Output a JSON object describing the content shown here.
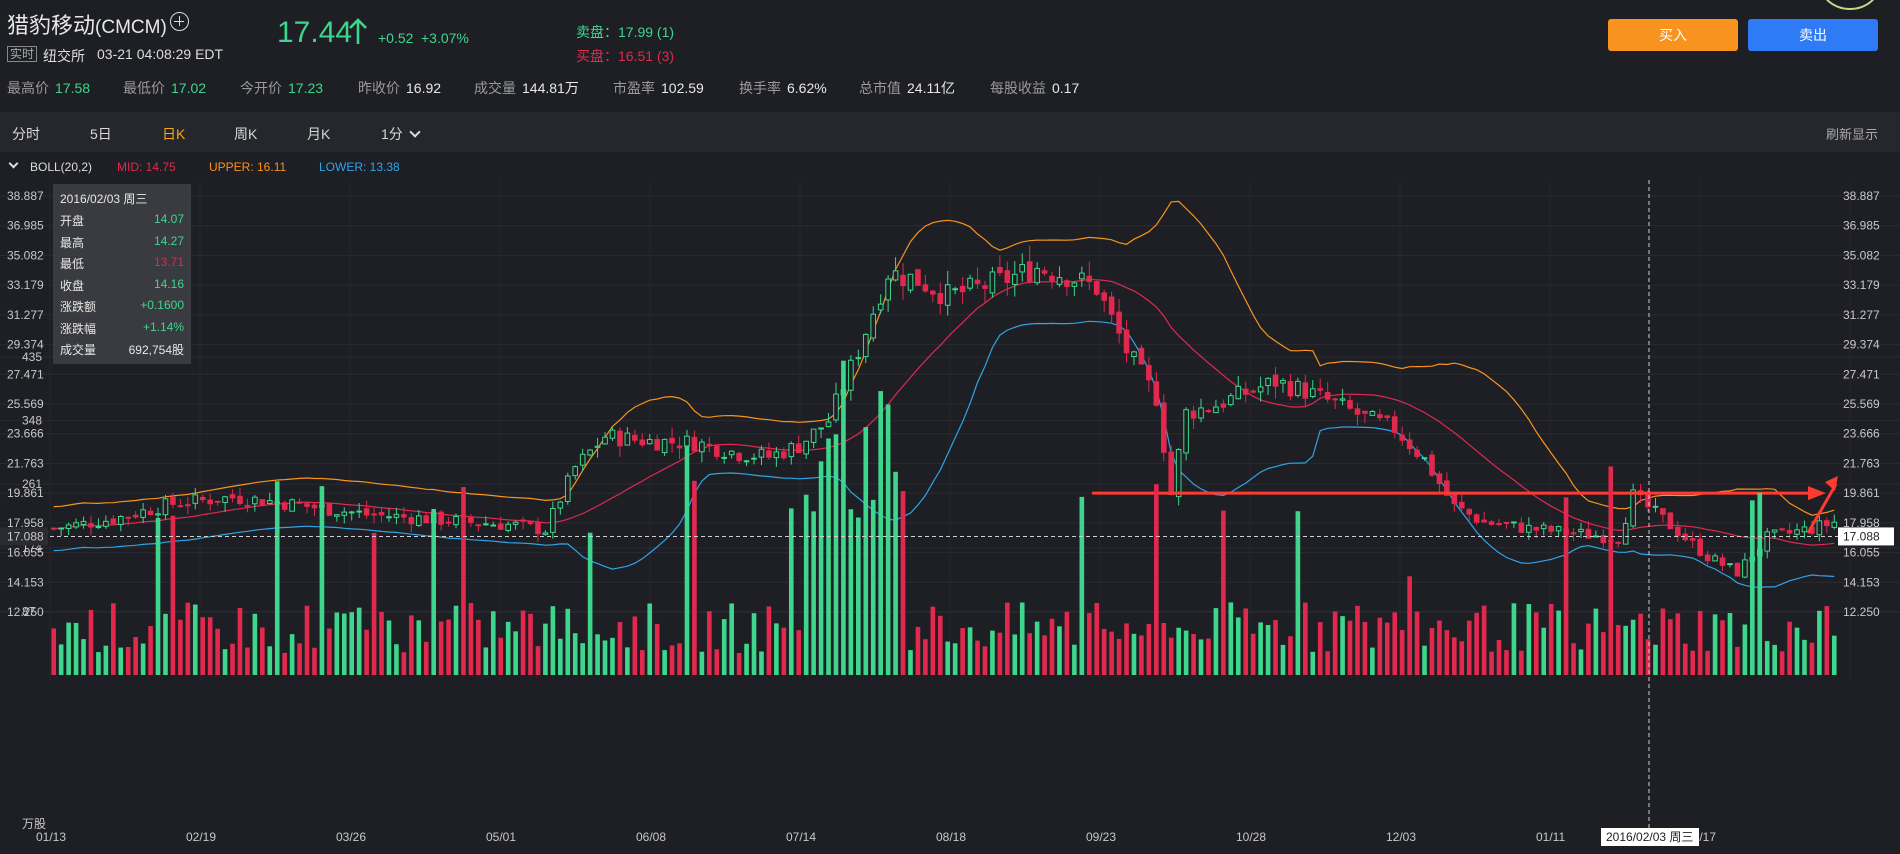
{
  "stock": {
    "name": "猎豹移动",
    "code": "(CMCM)",
    "realtime_badge": "实时",
    "exchange": "纽交所",
    "time": "03-21 04:08:29 EDT",
    "price": "17.44",
    "change": "+0.52",
    "change_pct": "+3.07%",
    "ask": "卖盘：17.99 (1)",
    "bid": "买盘：16.51 (3)"
  },
  "actions": {
    "buy": "买入",
    "sell": "卖出"
  },
  "stats": [
    {
      "label": "最高价",
      "value": "17.58",
      "up": true
    },
    {
      "label": "最低价",
      "value": "17.02",
      "up": true
    },
    {
      "label": "今开价",
      "value": "17.23",
      "up": true
    },
    {
      "label": "昨收价",
      "value": "16.92",
      "up": false
    },
    {
      "label": "成交量",
      "value": "144.81万",
      "up": false
    },
    {
      "label": "市盈率",
      "value": "102.59",
      "up": false
    },
    {
      "label": "换手率",
      "value": "6.62%",
      "up": false
    },
    {
      "label": "总市值",
      "value": "24.11亿",
      "up": false
    },
    {
      "label": "每股收益",
      "value": "0.17",
      "up": false
    }
  ],
  "tabs": [
    {
      "label": "分时",
      "active": false
    },
    {
      "label": "5日",
      "active": false
    },
    {
      "label": "日K",
      "active": true
    },
    {
      "label": "周K",
      "active": false
    },
    {
      "label": "月K",
      "active": false
    },
    {
      "label": "1分",
      "active": false
    }
  ],
  "refresh_label": "刷新显示",
  "indicator": {
    "name": "BOLL(20,2)",
    "mid": "MID: 14.75",
    "upper": "UPPER: 16.11",
    "lower": "LOWER: 13.38"
  },
  "tooltip": {
    "date": "2016/02/03 周三",
    "rows": [
      {
        "k": "开盘",
        "v": "14.07",
        "c": "up"
      },
      {
        "k": "最高",
        "v": "14.27",
        "c": "up"
      },
      {
        "k": "最低",
        "v": "13.71",
        "c": "dn"
      },
      {
        "k": "收盘",
        "v": "14.16",
        "c": "up"
      },
      {
        "k": "涨跌额",
        "v": "+0.1600",
        "c": "up"
      },
      {
        "k": "涨跌幅",
        "v": "+1.14%",
        "c": "up"
      },
      {
        "k": "成交量",
        "v": "692,754股",
        "c": "n"
      }
    ]
  },
  "chart_data": {
    "type": "candlestick",
    "y_ticks": [
      "38.887",
      "36.985",
      "35.082",
      "33.179",
      "31.277",
      "29.374",
      "27.471",
      "25.569",
      "23.666",
      "21.763",
      "19.861",
      "17.958",
      "16.055",
      "14.153",
      "12.250"
    ],
    "y_range": [
      12.25,
      38.887
    ],
    "crosshair_price": "17.088",
    "crosshair_date": "2016/02/03 周三",
    "x_labels": [
      "01/13",
      "02/19",
      "03/26",
      "05/01",
      "06/08",
      "07/14",
      "08/18",
      "09/23",
      "10/28",
      "12/03",
      "01/11",
      "02/17"
    ],
    "volume_ticks": [
      "435",
      "348",
      "261",
      "174",
      "87"
    ],
    "volume_unit": "万股",
    "volume_range": [
      0,
      435
    ],
    "bars_shown": 240,
    "colors": {
      "up": "#3dd68c",
      "down": "#e0294d",
      "mid": "#e0294d",
      "upper": "#f7931e",
      "lower": "#2fa4e7",
      "annotation": "#ff3b30"
    },
    "price_path": [
      [
        0,
        17.6
      ],
      [
        8,
        18.2
      ],
      [
        16,
        19.2
      ],
      [
        24,
        19.6
      ],
      [
        30,
        19.3
      ],
      [
        36,
        18.9
      ],
      [
        42,
        18.5
      ],
      [
        48,
        18.3
      ],
      [
        56,
        18.0
      ],
      [
        62,
        17.8
      ],
      [
        66,
        17.5
      ],
      [
        70,
        21.5
      ],
      [
        74,
        23.5
      ],
      [
        80,
        23.2
      ],
      [
        86,
        23.1
      ],
      [
        92,
        22.4
      ],
      [
        96,
        22.2
      ],
      [
        100,
        22.9
      ],
      [
        104,
        24.5
      ],
      [
        108,
        29.0
      ],
      [
        112,
        34.0
      ],
      [
        116,
        33.5
      ],
      [
        120,
        32.5
      ],
      [
        124,
        33.0
      ],
      [
        128,
        33.6
      ],
      [
        132,
        34.3
      ],
      [
        136,
        33.8
      ],
      [
        140,
        33.0
      ],
      [
        144,
        29.0
      ],
      [
        148,
        26.0
      ],
      [
        150,
        19.8
      ],
      [
        152,
        25.0
      ],
      [
        156,
        25.5
      ],
      [
        160,
        26.3
      ],
      [
        164,
        27.0
      ],
      [
        168,
        26.4
      ],
      [
        172,
        25.6
      ],
      [
        176,
        24.7
      ],
      [
        180,
        24.0
      ],
      [
        184,
        22.0
      ],
      [
        188,
        19.0
      ],
      [
        192,
        18.0
      ],
      [
        198,
        17.6
      ],
      [
        204,
        17.3
      ],
      [
        210,
        17.0
      ],
      [
        212,
        19.7
      ],
      [
        216,
        18.2
      ],
      [
        222,
        15.8
      ],
      [
        226,
        14.8
      ],
      [
        230,
        17.0
      ],
      [
        236,
        17.6
      ],
      [
        242,
        18.4
      ],
      [
        248,
        19.0
      ],
      [
        254,
        19.7
      ],
      [
        258,
        20.2
      ],
      [
        264,
        19.5
      ],
      [
        270,
        19.2
      ],
      [
        276,
        19.1
      ],
      [
        280,
        19.4
      ],
      [
        284,
        18.7
      ],
      [
        290,
        17.9
      ],
      [
        296,
        17.4
      ],
      [
        302,
        17.0
      ],
      [
        308,
        16.9
      ],
      [
        314,
        16.3
      ],
      [
        320,
        15.7
      ],
      [
        326,
        15.1
      ],
      [
        330,
        14.6
      ],
      [
        334,
        14.2
      ],
      [
        338,
        14.5
      ],
      [
        342,
        15.4
      ],
      [
        346,
        17.1
      ],
      [
        350,
        16.4
      ],
      [
        356,
        15.6
      ],
      [
        362,
        15.3
      ],
      [
        368,
        15.8
      ],
      [
        372,
        16.8
      ]
    ],
    "annotation": {
      "type": "horizontal-line-with-arrow",
      "price": 19.86
    }
  }
}
